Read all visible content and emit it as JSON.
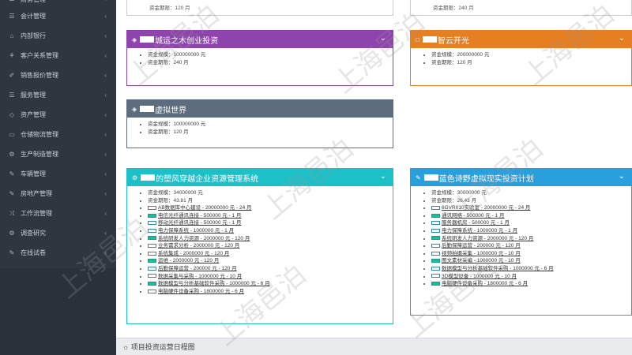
{
  "sidebar": {
    "items": [
      {
        "label": "财务管理",
        "icon": "list-icon"
      },
      {
        "label": "会计管理",
        "icon": "list-icon"
      },
      {
        "label": "内部银行",
        "icon": "bank-icon"
      },
      {
        "label": "客户关系管理",
        "icon": "users-icon"
      },
      {
        "label": "销售报价管理",
        "icon": "tag-icon"
      },
      {
        "label": "服务管理",
        "icon": "list-icon"
      },
      {
        "label": "资产管理",
        "icon": "gem-icon"
      },
      {
        "label": "仓储物流管理",
        "icon": "truck-icon"
      },
      {
        "label": "生产制造管理",
        "icon": "gear-icon"
      },
      {
        "label": "车辆管理",
        "icon": "edit-icon"
      },
      {
        "label": "房地产管理",
        "icon": "edit-icon"
      },
      {
        "label": "工作流管理",
        "icon": "shuffle-icon"
      },
      {
        "label": "调查研究",
        "icon": "gear-icon"
      },
      {
        "label": "在线试卷",
        "icon": "edit-icon"
      }
    ]
  },
  "top_strips": {
    "left": "资金期限：120 月",
    "right": "资金期限：240 月"
  },
  "panels": {
    "p1": {
      "title": "城运之木创业投资",
      "items": [
        "资金规模：100000000 元",
        "资金期限：240 月"
      ]
    },
    "p2": {
      "title": "智云开光",
      "items": [
        "资金规模：200000000 元",
        "资金期限：120 月"
      ]
    },
    "p3": {
      "title": "虚拟世界",
      "items": [
        "资金规模：100000000 元",
        "资金期限：120 月"
      ]
    },
    "p4": {
      "title": "的塑风穿越企业资源管理系统",
      "items": [
        "资金规模：34000000 元",
        "资金期限：43.81 月"
      ],
      "links": [
        "AB数据库中心建设 - 20000000 元 - 24 月",
        "电信光纤通讯连接 - 500000 元 - 1 月",
        "移动光纤通讯连接 - 500000 元 - 1 月",
        "电力保障系统 - 1000000 元 - 1 月",
        "系统研发人力资源 - 2000000 元 - 120 月",
        "业务需求分析 - 2000000 元 - 120 月",
        "系统集成 - 2000000 元 - 120 月",
        "运维 - 2000000 元 - 120 月",
        "后勤保障运营 - 200000 元 - 120 月",
        "数据采集与采购 - 1000000 元 - 10 月",
        "数据模型与分析基础软件采购 - 1000000 元 - 6 月",
        "电脑硬件设备采购 - 1800000 元 - 6 月"
      ]
    },
    "p5": {
      "title": "蓝色诗野虚拟现实投资计划",
      "items": [
        "资金规模：30000000 元",
        "资金期限：26.43 月"
      ],
      "links": [
        "6GVR010实验室 - 20000000 元 - 24 月",
        "通讯网络 - 500000 元 - 1 月",
        "服务器机房 - 500000 元 - 1 月",
        "电力保障系统 - 1000000 元 - 1 月",
        "系统研发人力资源 - 2000000 元 - 120 月",
        "后勤保障运营 - 200000 元 - 120 月",
        "视频拍摄采集 - 1000000 元 - 10 月",
        "图文素材采编 - 1000000 元 - 10 月",
        "数据模型与分析基础软件采购 - 1000000 元 - 6 月",
        "3D模型设备 - 1000000 元 - 10 月",
        "电脑硬件设备采购 - 1800000 元 - 6 月"
      ]
    }
  },
  "footer": {
    "schedule_title": "项目投资运营日程图"
  },
  "watermark": "上海邑泊",
  "colors": {
    "purple": "#8e44ad",
    "orange": "#e67e22",
    "slate": "#5d6d7e",
    "cyan": "#1ec0c8",
    "blue": "#2a9fdd",
    "sidebar": "#2f3640"
  }
}
